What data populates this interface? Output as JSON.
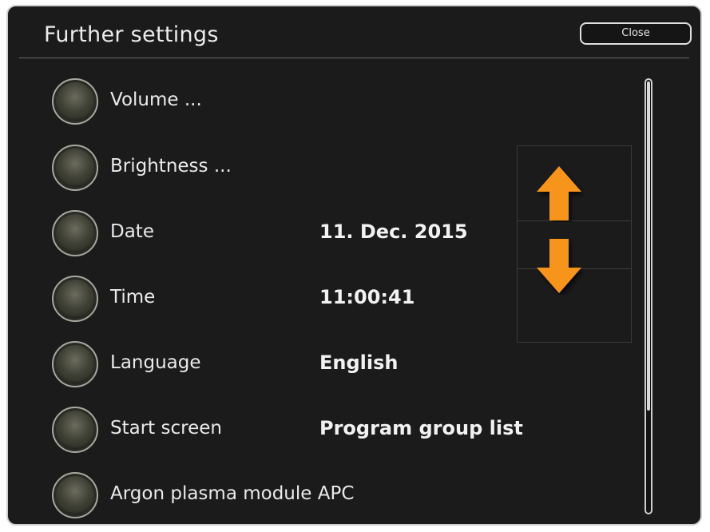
{
  "header": {
    "title": "Further settings",
    "close_label": "Close"
  },
  "settings": [
    {
      "label": "Volume ...",
      "value": ""
    },
    {
      "label": "Brightness ...",
      "value": ""
    },
    {
      "label": "Date",
      "value": "11. Dec. 2015"
    },
    {
      "label": "Time",
      "value": "11:00:41"
    },
    {
      "label": "Language",
      "value": "English"
    },
    {
      "label": "Start screen",
      "value": "Program group list"
    },
    {
      "label": "Argon plasma module APC",
      "value": ""
    }
  ],
  "icons": {
    "up": "arrow-up-icon",
    "down": "arrow-down-icon"
  },
  "colors": {
    "background": "#1b1b1b",
    "text": "#eaeaea",
    "accent_arrow": "#f7941d",
    "knob": "#3f4035"
  }
}
